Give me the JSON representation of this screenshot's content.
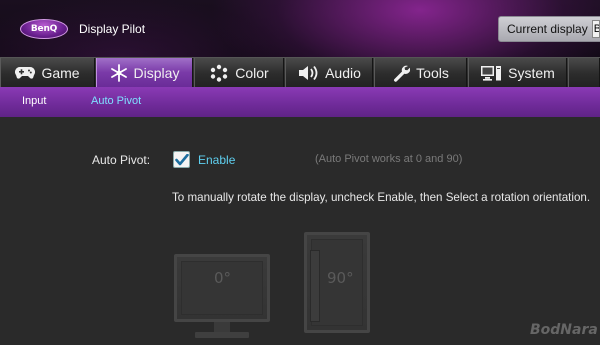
{
  "header": {
    "logo_text": "BenQ",
    "app_title": "Display Pilot",
    "current_display_label": "Current display",
    "current_display_value": "B"
  },
  "tabs": [
    {
      "label": "Game",
      "icon": "gamepad-icon",
      "active": false
    },
    {
      "label": "Display",
      "icon": "display-snowflake-icon",
      "active": true
    },
    {
      "label": "Color",
      "icon": "color-dots-icon",
      "active": false
    },
    {
      "label": "Audio",
      "icon": "speaker-icon",
      "active": false
    },
    {
      "label": "Tools",
      "icon": "wrench-icon",
      "active": false
    },
    {
      "label": "System",
      "icon": "computer-icon",
      "active": false
    }
  ],
  "subtabs": [
    {
      "label": "Input",
      "active": false
    },
    {
      "label": "Auto Pivot",
      "active": true
    }
  ],
  "content": {
    "auto_pivot_label": "Auto Pivot:",
    "enable_label": "Enable",
    "enable_checked": true,
    "hint": "(Auto Pivot works at 0 and 90)",
    "description": "To manually rotate the display, uncheck Enable, then Select a rotation orientation.",
    "landscape_label": "0°",
    "portrait_label": "90°"
  },
  "watermark": "BodNara",
  "colors": {
    "accent_purple": "#7a3aa8",
    "enable_cyan": "#5fd0f0",
    "active_subtab": "#7fe0ff"
  }
}
